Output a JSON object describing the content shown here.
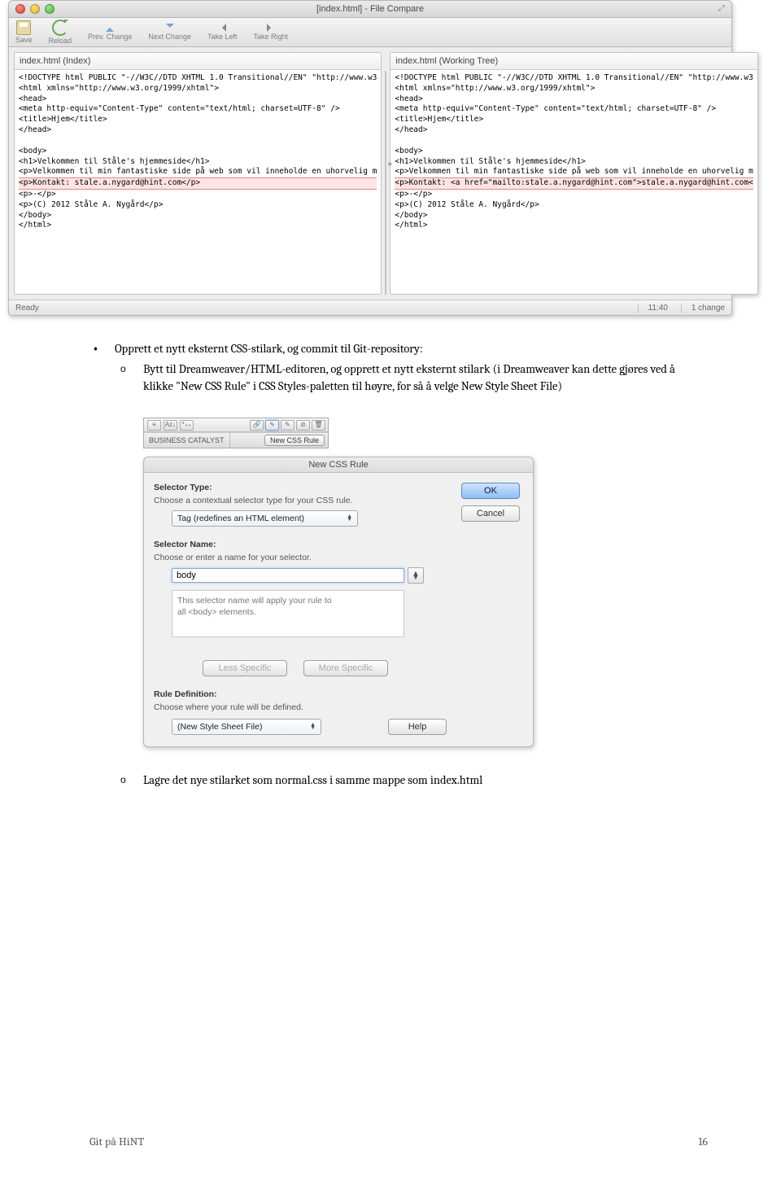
{
  "bullets": {
    "l1": "Opprett et nytt eksternt CSS-stilark, og commit til Git-repository:",
    "l2a": "Bytt til Dreamweaver/HTML-editoren, og opprett et nytt eksternt stilark (i Dreamweaver kan dette gjøres ved å klikke \"New CSS Rule\" i CSS Styles-paletten til høyre, for så å velge New Style Sheet File)",
    "l2b": "Lagre det nye stilarket som normal.css i samme mappe som index.html"
  },
  "fc": {
    "title": "[index.html] - File Compare",
    "toolbar": [
      "Save",
      "Reload",
      "Prev. Change",
      "Next Change",
      "Take Left",
      "Take Right"
    ],
    "left_header": "index.html (Index)",
    "right_header": "index.html (Working Tree)",
    "code_common_pre": "<!DOCTYPE html PUBLIC \"-//W3C//DTD XHTML 1.0 Transitional//EN\" \"http://www.w3\n<html xmlns=\"http://www.w3.org/1999/xhtml\">\n<head>\n<meta http-equiv=\"Content-Type\" content=\"text/html; charset=UTF-8\" />\n<title>Hjem</title>\n</head>\n\n<body>\n<h1>Velkommen til Ståle's hjemmeside</h1>\n<p>Velkommen til min fantastiske side på web som vil inneholde en uhorvelig m",
    "left_diff": "<p>Kontakt: stale.a.nygard@hint.com</p>",
    "right_diff": "<p>Kontakt: <a href=\"mailto:stale.a.nygard@hint.com\">stale.a.nygard@hint.com<",
    "code_common_post": "<p>-</p>\n<p>(C) 2012 Ståle A. Nygård</p>\n</body>\n</html>",
    "status_left": "Ready",
    "status_pos": "11:40",
    "status_changes": "1 change"
  },
  "palette": {
    "tab": "BUSINESS CATALYST",
    "btn": "New CSS Rule"
  },
  "ncr": {
    "title": "New CSS Rule",
    "selector_type_label": "Selector Type:",
    "selector_type_desc": "Choose a contextual selector type for your CSS rule.",
    "selector_type_value": "Tag (redefines an HTML element)",
    "selector_name_label": "Selector Name:",
    "selector_name_desc": "Choose or enter a name for your selector.",
    "selector_name_value": "body",
    "hint": "This selector name will apply your rule to\nall <body> elements.",
    "less": "Less Specific",
    "more": "More Specific",
    "rule_def_label": "Rule Definition:",
    "rule_def_desc": "Choose where your rule will be defined.",
    "rule_def_value": "(New Style Sheet File)",
    "ok": "OK",
    "cancel": "Cancel",
    "help": "Help"
  },
  "footer": {
    "left": "Git på HiNT",
    "right": "16"
  }
}
